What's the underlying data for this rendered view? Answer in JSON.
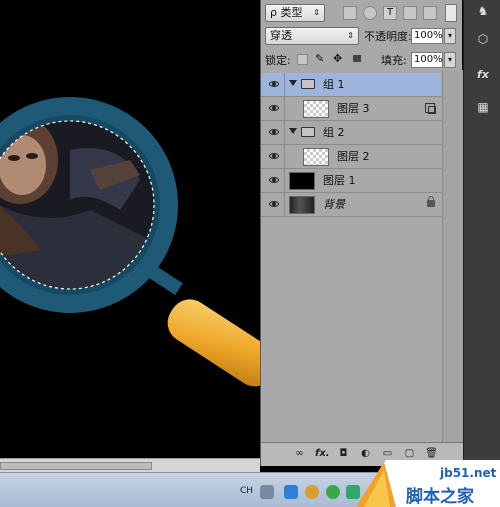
{
  "panel": {
    "filter_type": "ρ 类型",
    "blend_mode": "穿透",
    "opacity_label": "不透明度:",
    "opacity_value": "100%",
    "lock_label": "锁定:",
    "fill_label": "填充:",
    "fill_value": "100%",
    "layers": [
      {
        "name": "组 1",
        "kind": "group",
        "selected": true
      },
      {
        "name": "图层 3",
        "kind": "layer",
        "selected": false
      },
      {
        "name": "组 2",
        "kind": "group",
        "selected": false
      },
      {
        "name": "图层 2",
        "kind": "layer",
        "selected": false
      },
      {
        "name": "图层 1",
        "kind": "layer",
        "selected": false
      },
      {
        "name": "背景",
        "kind": "background",
        "selected": false
      }
    ],
    "footer_fx": "fx."
  },
  "taskbar": {
    "lang": "CH"
  },
  "watermark": {
    "site": "jb51.net",
    "name": "脚本之家"
  },
  "colors": {
    "panel_bg": "#a9a9a9",
    "selection": "#9db5dc",
    "magnifier_ring": "#1e5a76",
    "magnifier_handle": "#f0b43c"
  }
}
